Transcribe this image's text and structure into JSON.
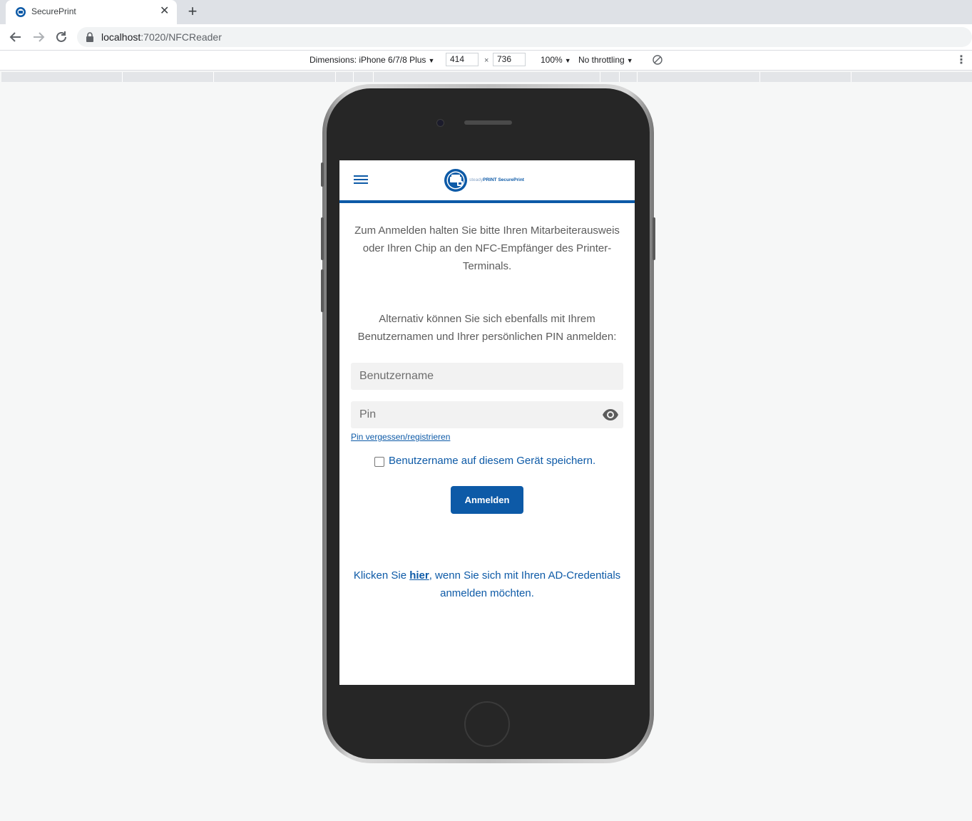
{
  "browser": {
    "tab_title": "SecurePrint",
    "tab_close": "✕",
    "new_tab": "+",
    "url_host": "localhost",
    "url_path": ":7020/NFCReader"
  },
  "devtools": {
    "dimensions_label": "Dimensions: iPhone 6/7/8 Plus",
    "width": "414",
    "times": "×",
    "height": "736",
    "zoom": "100%",
    "throttling": "No throttling",
    "caret": "▼"
  },
  "app": {
    "logo_text_light": "steady",
    "logo_text_bold": "PRINT SecurePrint",
    "brand_color": "#0d5aa7",
    "intro": "Zum Anmelden halten Sie bitte Ihren Mitarbeiterausweis oder Ihren Chip an den NFC-Empfänger des Printer-Terminals.",
    "alternative": "Alternativ können Sie sich ebenfalls mit Ihrem Benutzernamen und Ihrer persönlichen PIN anmelden:",
    "username_placeholder": "Benutzername",
    "pin_placeholder": "Pin",
    "pin_link": "Pin vergessen/registrieren",
    "remember_label": "Benutzername auf diesem Gerät speichern.",
    "login_button": "Anmelden",
    "ad_prefix": "Klicken Sie ",
    "ad_link": "hier",
    "ad_suffix": ", wenn Sie sich mit Ihren AD-Credentials anmelden möchten."
  }
}
